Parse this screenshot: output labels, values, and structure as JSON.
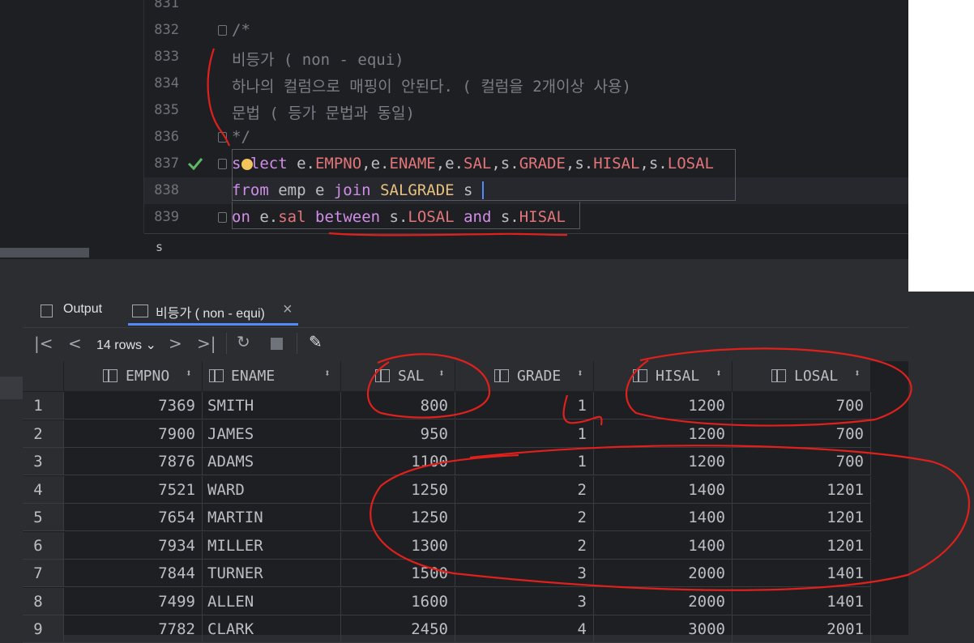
{
  "editor": {
    "lines": [
      {
        "no": "831"
      },
      {
        "no": "832"
      },
      {
        "no": "833"
      },
      {
        "no": "834"
      },
      {
        "no": "835"
      },
      {
        "no": "836"
      },
      {
        "no": "837"
      },
      {
        "no": "838"
      },
      {
        "no": "839"
      }
    ],
    "comment_open": "/*",
    "comment_1": "비등가 ( non - equi)",
    "comment_2": "하나의 컬럼으로 매핑이 안된다. ( 컬럼을 2개이상 사용)",
    "comment_3": "문법 ( 등가 문법과 동일)",
    "comment_close": "*/",
    "sql_line1": {
      "kw_select": "select",
      "p1": " e.",
      "f1": "EMPNO",
      "p2": ",e.",
      "f2": "ENAME",
      "p3": ",e.",
      "f3": "SAL",
      "p4": ",s.",
      "f4": "GRADE",
      "p5": ",s.",
      "f5": "HISAL",
      "p6": ",s.",
      "f6": "LOSAL"
    },
    "sql_line2": {
      "kw_from": "from",
      "t1": " emp e ",
      "kw_join": "join",
      "t2": " ",
      "tbl": "SALGRADE",
      "t3": " s"
    },
    "sql_line3": {
      "kw_on": "on",
      "t1": " e.",
      "f1": "sal",
      "t2": " ",
      "kw_between": "between",
      "t3": " s.",
      "f2": "LOSAL",
      "t4": " ",
      "kw_and": "and",
      "t5": " s.",
      "f3": "HISAL"
    },
    "status_text": "s"
  },
  "tool_window": {
    "tabs": [
      {
        "label": "Output",
        "icon": "output-icon"
      },
      {
        "label": "비등가 ( non - equi)",
        "icon": "table-icon",
        "active": true
      }
    ],
    "close_glyph": "×",
    "rows_label": "14 rows",
    "toolbar_icons": [
      "first-page-icon",
      "prev-page-icon",
      "next-page-icon",
      "last-page-icon",
      "refresh-icon",
      "stop-icon",
      "pin-icon"
    ]
  },
  "table": {
    "columns": [
      "EMPNO",
      "ENAME",
      "SAL",
      "GRADE",
      "HISAL",
      "LOSAL"
    ],
    "rows": [
      {
        "n": "1",
        "EMPNO": "7369",
        "ENAME": "SMITH",
        "SAL": "800",
        "GRADE": "1",
        "HISAL": "1200",
        "LOSAL": "700"
      },
      {
        "n": "2",
        "EMPNO": "7900",
        "ENAME": "JAMES",
        "SAL": "950",
        "GRADE": "1",
        "HISAL": "1200",
        "LOSAL": "700"
      },
      {
        "n": "3",
        "EMPNO": "7876",
        "ENAME": "ADAMS",
        "SAL": "1100",
        "GRADE": "1",
        "HISAL": "1200",
        "LOSAL": "700"
      },
      {
        "n": "4",
        "EMPNO": "7521",
        "ENAME": "WARD",
        "SAL": "1250",
        "GRADE": "2",
        "HISAL": "1400",
        "LOSAL": "1201"
      },
      {
        "n": "5",
        "EMPNO": "7654",
        "ENAME": "MARTIN",
        "SAL": "1250",
        "GRADE": "2",
        "HISAL": "1400",
        "LOSAL": "1201"
      },
      {
        "n": "6",
        "EMPNO": "7934",
        "ENAME": "MILLER",
        "SAL": "1300",
        "GRADE": "2",
        "HISAL": "1400",
        "LOSAL": "1201"
      },
      {
        "n": "7",
        "EMPNO": "7844",
        "ENAME": "TURNER",
        "SAL": "1500",
        "GRADE": "3",
        "HISAL": "2000",
        "LOSAL": "1401"
      },
      {
        "n": "8",
        "EMPNO": "7499",
        "ENAME": "ALLEN",
        "SAL": "1600",
        "GRADE": "3",
        "HISAL": "2000",
        "LOSAL": "1401"
      },
      {
        "n": "9",
        "EMPNO": "7782",
        "ENAME": "CLARK",
        "SAL": "2450",
        "GRADE": "4",
        "HISAL": "3000",
        "LOSAL": "2001"
      }
    ]
  },
  "colors": {
    "annotation": "#e0201c",
    "accent": "#548af7",
    "check": "#5fb865"
  }
}
